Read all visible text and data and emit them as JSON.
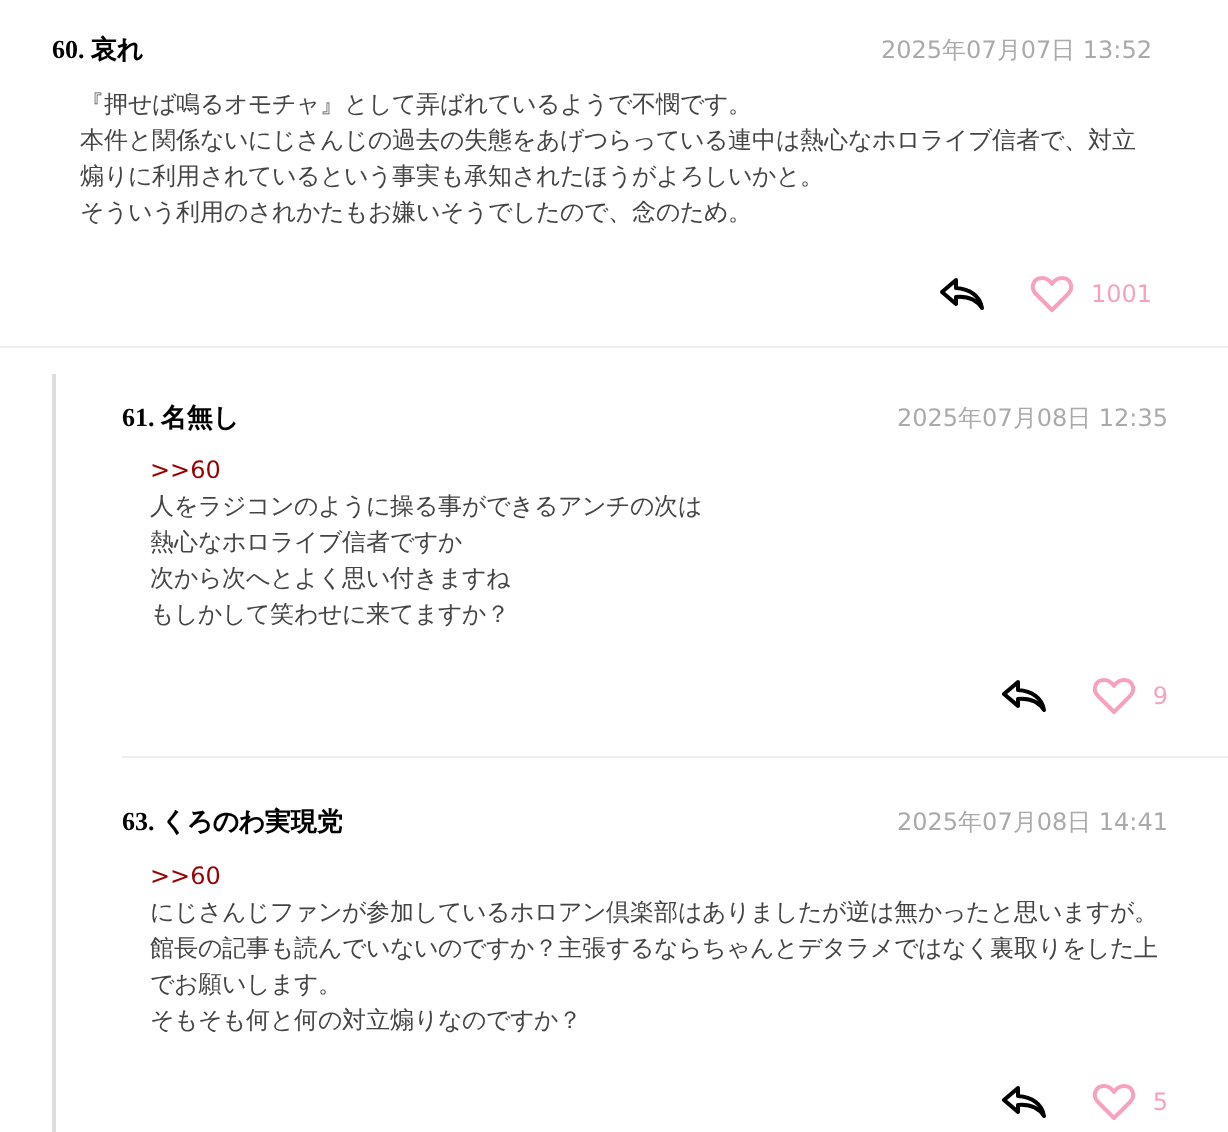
{
  "comments": [
    {
      "number": "60.",
      "name": "哀れ",
      "date": "2025年07月07日 13:52",
      "lines": [
        "『押せば鳴るオモチャ』として弄ばれているようで不憫です。",
        "本件と関係ないにじさんじの過去の失態をあげつらっている連中は熱心なホロライブ信者で、対立煽りに利用されているという事実も承知されたほうがよろしいかと。",
        "そういう利用のされかたもお嫌いそうでしたので、念のため。"
      ],
      "likes": "1001",
      "children": [
        {
          "number": "61.",
          "name": "名無し",
          "date": "2025年07月08日 12:35",
          "anchor": ">>60",
          "lines": [
            "人をラジコンのように操る事ができるアンチの次は",
            "熱心なホロライブ信者ですか",
            "次から次へとよく思い付きますね",
            "もしかして笑わせに来てますか？"
          ],
          "likes": "9"
        },
        {
          "number": "63.",
          "name": "くろのわ実現党",
          "date": "2025年07月08日 14:41",
          "anchor": ">>60",
          "lines": [
            "にじさんじファンが参加しているホロアン倶楽部はありましたが逆は無かったと思いますが。",
            "館長の記事も読んでいないのですか？主張するならちゃんとデタラメではなく裏取りをした上でお願いします。",
            "そもそも何と何の対立煽りなのですか？"
          ],
          "likes": "5"
        }
      ]
    }
  ]
}
